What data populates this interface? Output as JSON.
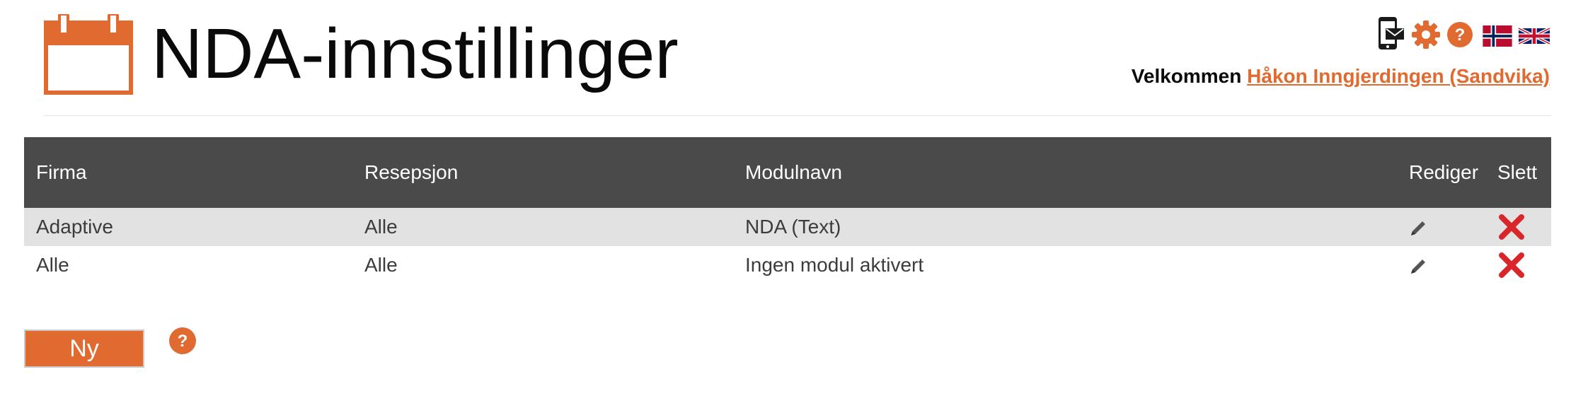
{
  "header": {
    "title": "NDA-innstillinger",
    "welcome_label": "Velkommen",
    "user_link": "Håkon Inngjerdingen (Sandvika)",
    "icons": [
      "mobile-mail-icon",
      "gear-icon",
      "help-icon",
      "flag-norway-icon",
      "flag-uk-icon"
    ]
  },
  "table": {
    "headers": {
      "firma": "Firma",
      "resepsjon": "Resepsjon",
      "modulnavn": "Modulnavn",
      "rediger": "Rediger",
      "slett": "Slett"
    },
    "rows": [
      {
        "firma": "Adaptive",
        "resepsjon": "Alle",
        "modulnavn": "NDA (Text)"
      },
      {
        "firma": "Alle",
        "resepsjon": "Alle",
        "modulnavn": "Ingen modul aktivert"
      }
    ]
  },
  "actions": {
    "new_label": "Ny"
  },
  "colors": {
    "accent": "#e06a30",
    "header_bg": "#4a4a4a",
    "row_alt": "#e2e2e2",
    "delete_red": "#d8262a"
  }
}
